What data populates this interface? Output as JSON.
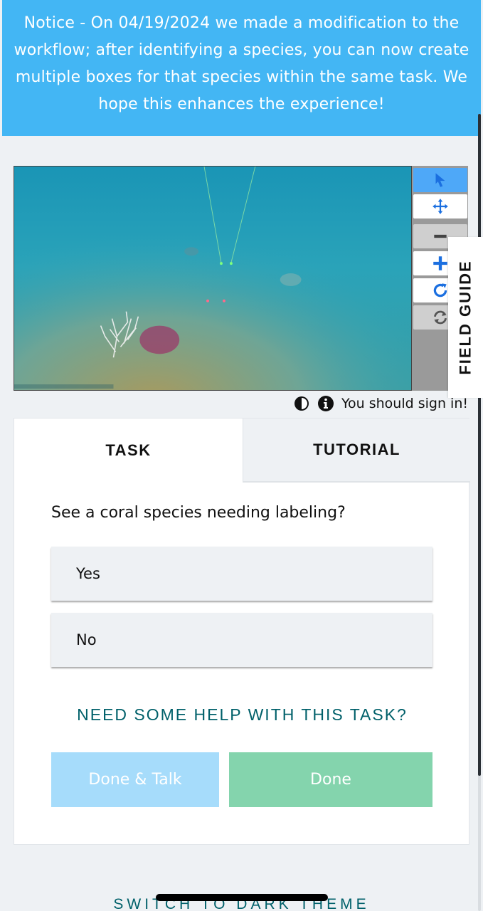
{
  "notice": {
    "text": "Notice - On 04/19/2024 we made a modification to the workflow; after identifying a species, you can now create multiple boxes for that species within the same task. We hope this enhances the experience!",
    "background": "#43b6f4"
  },
  "viewer": {
    "image_description": "underwater seafloor with white and red coral",
    "water_color": "#1e9ab8"
  },
  "tools": [
    {
      "name": "pointer",
      "icon": "cursor-arrow-icon",
      "state": "active"
    },
    {
      "name": "move",
      "icon": "move-arrows-icon",
      "state": "white"
    },
    {
      "name": "zoom-out",
      "icon": "minus-icon",
      "state": "grey"
    },
    {
      "name": "zoom-in",
      "icon": "plus-icon",
      "state": "white"
    },
    {
      "name": "rotate",
      "icon": "rotate-icon",
      "state": "white"
    },
    {
      "name": "reset",
      "icon": "reset-icon",
      "state": "grey"
    }
  ],
  "field_guide": {
    "label": "FIELD GUIDE"
  },
  "meta": {
    "sign_in": "You should sign in!",
    "icons": [
      "contrast-icon",
      "info-icon"
    ]
  },
  "tabs": {
    "task": "TASK",
    "tutorial": "TUTORIAL"
  },
  "task": {
    "question": "See a coral species needing labeling?",
    "answers": [
      "Yes",
      "No"
    ],
    "help": "NEED SOME HELP WITH THIS TASK?",
    "done_talk": "Done & Talk",
    "done": "Done"
  },
  "footer": {
    "dark_theme": "SWITCH TO DARK THEME"
  },
  "colors": {
    "accent_blue": "#43b6f4",
    "teal_text": "#00606a",
    "done_green": "#84d4ad",
    "done_talk_blue": "#a6dcfb"
  }
}
